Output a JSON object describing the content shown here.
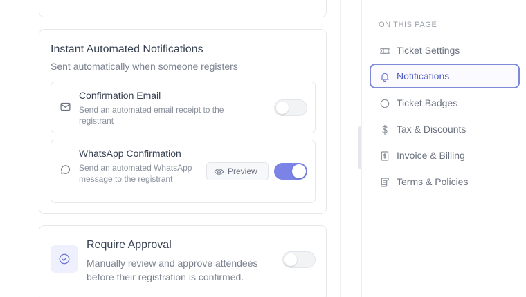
{
  "instant_notifications": {
    "title": "Instant Automated Notifications",
    "subtitle": "Sent automatically when someone registers",
    "email": {
      "icon": "mail-icon",
      "title": "Confirmation Email",
      "description": "Send an automated email receipt to the registrant",
      "enabled": false
    },
    "whatsapp": {
      "icon": "chat-bubble-icon",
      "title": "WhatsApp Confirmation",
      "description": "Send an automated WhatsApp message to the registrant",
      "preview_label": "Preview",
      "enabled": true
    }
  },
  "approval": {
    "icon": "check-circle-icon",
    "title": "Require Approval",
    "description": "Manually review and approve attendees before their registration is confirmed.",
    "enabled": false
  },
  "toc": {
    "heading": "ON THIS PAGE",
    "items": [
      {
        "label": "Ticket Settings",
        "icon": "ticket-icon",
        "active": false
      },
      {
        "label": "Notifications",
        "icon": "bell-icon",
        "active": true
      },
      {
        "label": "Ticket Badges",
        "icon": "circle-icon",
        "active": false
      },
      {
        "label": "Tax & Discounts",
        "icon": "dollar-icon",
        "active": false
      },
      {
        "label": "Invoice & Billing",
        "icon": "invoice-icon",
        "active": false
      },
      {
        "label": "Terms & Policies",
        "icon": "scroll-icon",
        "active": false
      }
    ]
  },
  "colors": {
    "accent": "#7b84e6",
    "active_border": "#7e8ad6",
    "active_text": "#4e5cc0"
  }
}
